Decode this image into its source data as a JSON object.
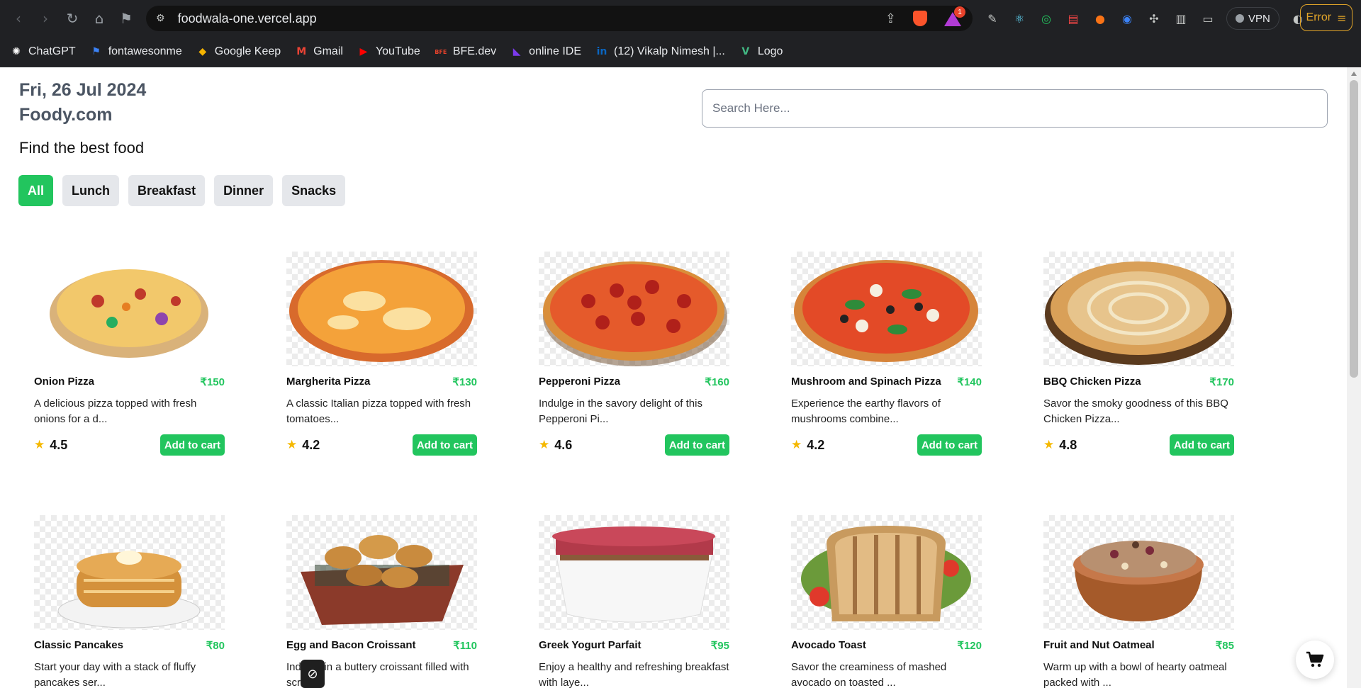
{
  "browser": {
    "url": "foodwala-one.vercel.app",
    "rewards_badge": "1",
    "vpn_label": "VPN",
    "error_label": "Error",
    "bookmarks": [
      {
        "label": "ChatGPT",
        "icon": "chatgpt-icon",
        "color": "#ffffff"
      },
      {
        "label": "fontawesonme",
        "icon": "flag-icon",
        "color": "#3b82f6"
      },
      {
        "label": "Google Keep",
        "icon": "keep-icon",
        "color": "#f5b400"
      },
      {
        "label": "Gmail",
        "icon": "gmail-icon",
        "color": "#ea4335"
      },
      {
        "label": "YouTube",
        "icon": "youtube-icon",
        "color": "#ff0000"
      },
      {
        "label": "BFE.dev",
        "icon": "bfe-icon",
        "color": "#e8422b"
      },
      {
        "label": "online IDE",
        "icon": "ide-icon",
        "color": "#7c3aed"
      },
      {
        "label": "(12) Vikalp Nimesh |...",
        "icon": "linkedin-icon",
        "color": "#0a66c2"
      },
      {
        "label": "Logo",
        "icon": "vue-icon",
        "color": "#42b883"
      }
    ]
  },
  "header": {
    "date": "Fri, 26 Jul 2024",
    "brand": "Foody.com",
    "tagline": "Find the best food",
    "search_placeholder": "Search Here..."
  },
  "filters": [
    "All",
    "Lunch",
    "Breakfast",
    "Dinner",
    "Snacks"
  ],
  "active_filter": "All",
  "add_to_cart_label": "Add to cart",
  "currency": "₹",
  "foods": [
    {
      "name": "Onion Pizza",
      "price": "₹150",
      "desc": "A delicious pizza topped with fresh onions for a d...",
      "rating": "4.5",
      "visual": "pizza-onion"
    },
    {
      "name": "Margherita Pizza",
      "price": "₹130",
      "desc": "A classic Italian pizza topped with fresh tomatoes...",
      "rating": "4.2",
      "visual": "pizza-margherita"
    },
    {
      "name": "Pepperoni Pizza",
      "price": "₹160",
      "desc": "Indulge in the savory delight of this Pepperoni Pi...",
      "rating": "4.6",
      "visual": "pizza-pepperoni"
    },
    {
      "name": "Mushroom and Spinach Pizza",
      "price": "₹140",
      "desc": "Experience the earthy flavors of mushrooms combine...",
      "rating": "4.2",
      "visual": "pizza-mushroom"
    },
    {
      "name": "BBQ Chicken Pizza",
      "price": "₹170",
      "desc": "Savor the smoky goodness of this BBQ Chicken Pizza...",
      "rating": "4.8",
      "visual": "pizza-bbq"
    },
    {
      "name": "Classic Pancakes",
      "price": "₹80",
      "desc": "Start your day with a stack of fluffy pancakes ser...",
      "rating": "",
      "visual": "pancakes"
    },
    {
      "name": "Egg and Bacon Croissant",
      "price": "₹110",
      "desc": "Indulge in a buttery croissant filled with scr...",
      "rating": "",
      "visual": "croissants"
    },
    {
      "name": "Greek Yogurt Parfait",
      "price": "₹95",
      "desc": "Enjoy a healthy and refreshing breakfast with laye...",
      "rating": "",
      "visual": "parfait"
    },
    {
      "name": "Avocado Toast",
      "price": "₹120",
      "desc": "Savor the creaminess of mashed avocado on toasted ...",
      "rating": "",
      "visual": "toast"
    },
    {
      "name": "Fruit and Nut Oatmeal",
      "price": "₹85",
      "desc": "Warm up with a bowl of hearty oatmeal packed with ...",
      "rating": "",
      "visual": "oatmeal"
    }
  ],
  "colors": {
    "accent": "#22c55e",
    "star": "#f5b800",
    "heading": "#4b5563"
  }
}
